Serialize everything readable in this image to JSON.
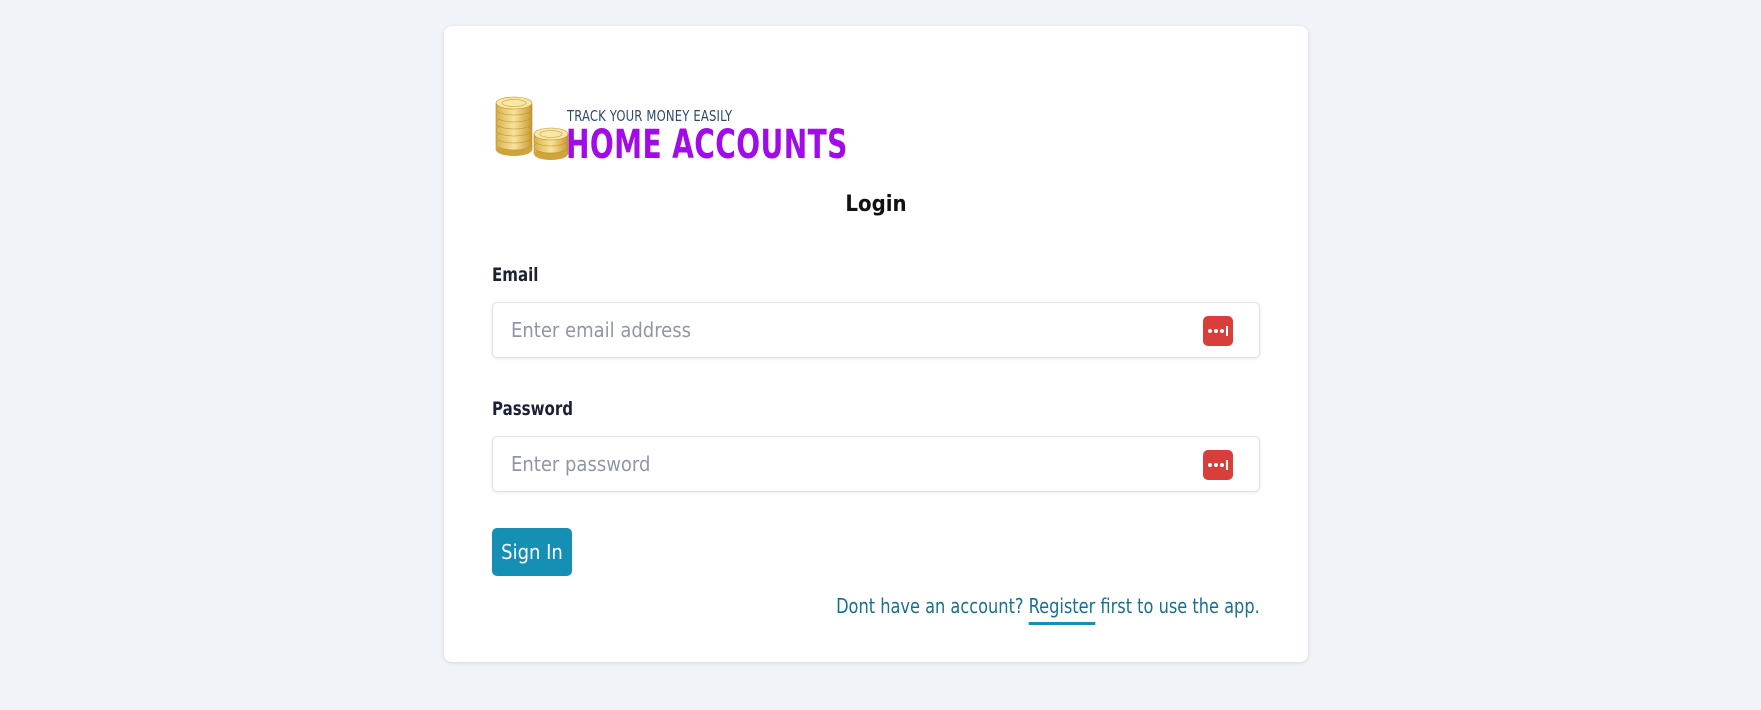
{
  "logo": {
    "tagline": "TRACK YOUR MONEY EASILY",
    "brand": "HOME ACCOUNTS",
    "brand_color": "#a00be8",
    "icon": "coins-stack-icon"
  },
  "form": {
    "title": "Login",
    "email_label": "Email",
    "email_placeholder": "Enter email address",
    "password_label": "Password",
    "password_placeholder": "Enter password",
    "password_manager_icon": "password-manager-icon",
    "password_manager_color": "#d93f3a",
    "submit_label": "Sign In",
    "submit_color": "#1590b4"
  },
  "register": {
    "prefix": "Dont have an account? ",
    "link_label": "Register",
    "suffix": " first to use the app."
  }
}
